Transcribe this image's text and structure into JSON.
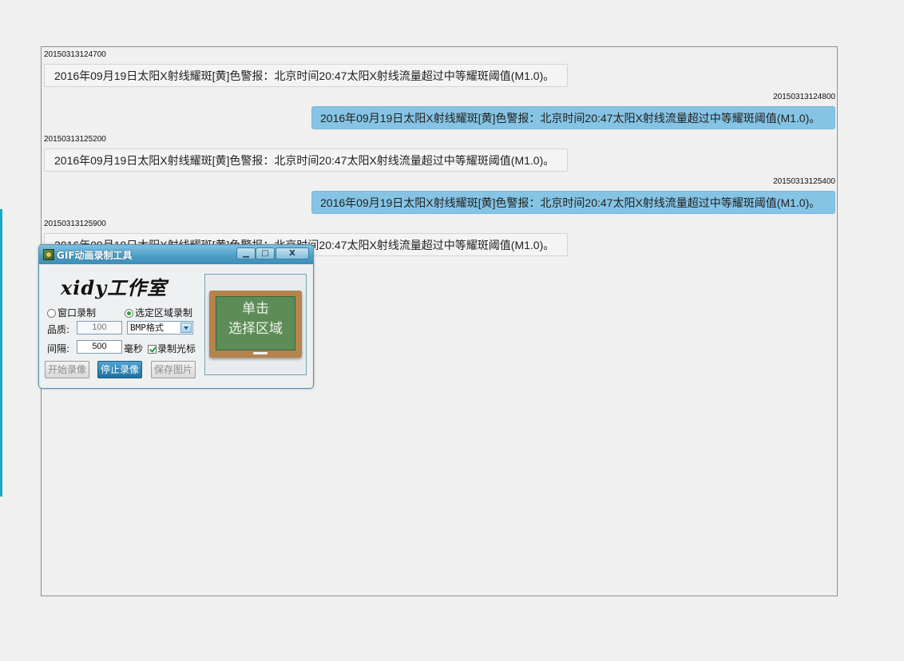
{
  "chat": {
    "messages": [
      {
        "side": "left",
        "time": "20150313124700",
        "text": "2016年09月19日太阳X射线耀斑[黄]色警报：北京时间20:47太阳X射线流量超过中等耀斑阈值(M1.0)。"
      },
      {
        "side": "right",
        "time": "20150313124800",
        "text": "2016年09月19日太阳X射线耀斑[黄]色警报：北京时间20:47太阳X射线流量超过中等耀斑阈值(M1.0)。"
      },
      {
        "side": "left",
        "time": "20150313125200",
        "text": "2016年09月19日太阳X射线耀斑[黄]色警报：北京时间20:47太阳X射线流量超过中等耀斑阈值(M1.0)。"
      },
      {
        "side": "right",
        "time": "20150313125400",
        "text": "2016年09月19日太阳X射线耀斑[黄]色警报：北京时间20:47太阳X射线流量超过中等耀斑阈值(M1.0)。"
      },
      {
        "side": "left",
        "time": "20150313125900",
        "text": "2016年09月19日太阳X射线耀斑[黄]色警报：北京时间20:47太阳X射线流量超过中等耀斑阈值(M1.0)。"
      }
    ]
  },
  "tool": {
    "title": "GIF动画录制工具",
    "close_glyph": "X",
    "studio": "xidy工作室",
    "radio_window": "窗口录制",
    "radio_region": "选定区域录制",
    "quality_label": "品质:",
    "quality_value": "100",
    "format_value": "BMP格式",
    "interval_label": "间隔:",
    "interval_value": "500",
    "interval_unit": "毫秒",
    "cursor_label": "录制光标",
    "start_label": "开始录像",
    "stop_label": "停止录像",
    "save_label": "保存图片",
    "board_line1": "单击",
    "board_line2": "选择区域"
  },
  "colors": {
    "right_bubble": "#85c4e4",
    "titlebar": "#4e9fc7",
    "accent": "#1aa9c4"
  }
}
